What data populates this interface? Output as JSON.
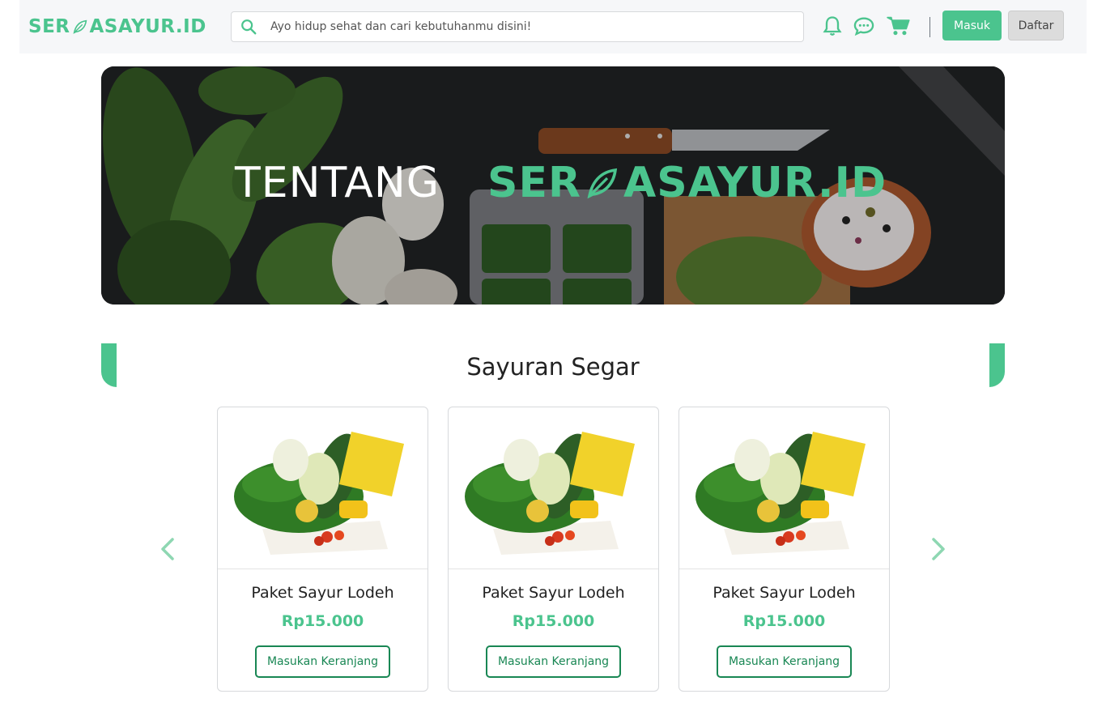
{
  "navbar": {
    "logo_left": "SER",
    "logo_right": "ASAYUR.ID",
    "search_placeholder": "Ayo hidup sehat dan cari kebutuhanmu disini!",
    "login_label": "Masuk",
    "register_label": "Daftar"
  },
  "hero": {
    "title_prefix": "TENTANG",
    "brand_left": "SER",
    "brand_right": "ASAYUR.ID"
  },
  "section": {
    "title": "Sayuran Segar"
  },
  "products": [
    {
      "name": "Paket Sayur Lodeh",
      "price": "Rp15.000",
      "button": "Masukan Keranjang"
    },
    {
      "name": "Paket Sayur Lodeh",
      "price": "Rp15.000",
      "button": "Masukan Keranjang"
    },
    {
      "name": "Paket Sayur Lodeh",
      "price": "Rp15.000",
      "button": "Masukan Keranjang"
    }
  ],
  "colors": {
    "brand": "#4bc48e",
    "button_outline": "#198754",
    "navbar_bg": "#f6f7f9"
  },
  "icons": [
    "search-icon",
    "bell-icon",
    "chat-icon",
    "cart-icon",
    "leaf-icon",
    "chevron-left-icon",
    "chevron-right-icon"
  ]
}
